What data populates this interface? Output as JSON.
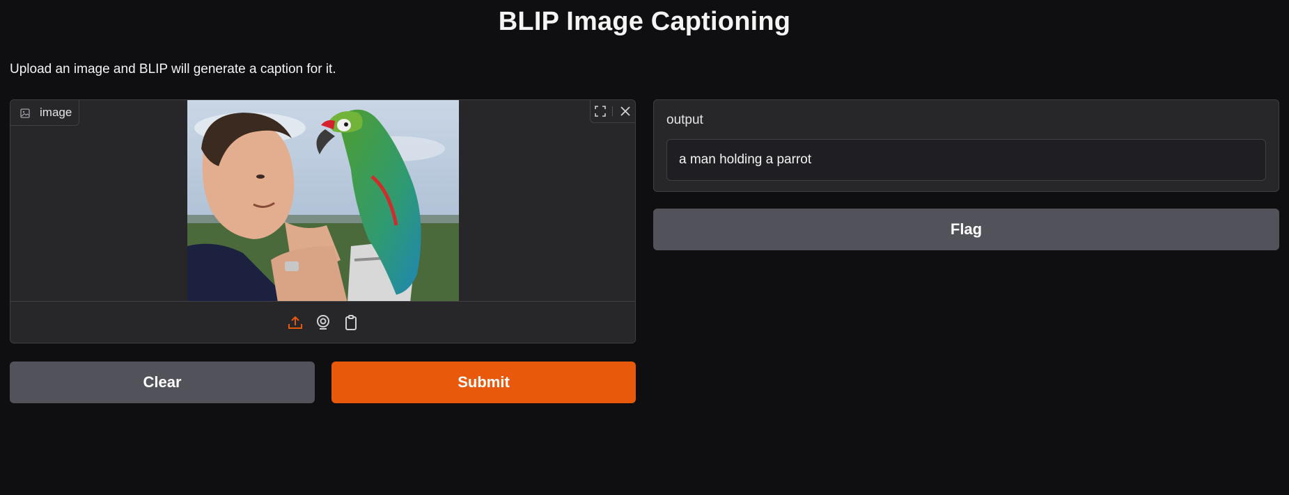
{
  "header": {
    "title": "BLIP Image Captioning",
    "description": "Upload an image and BLIP will generate a caption for it."
  },
  "input_image": {
    "label": "image",
    "label_icon": "image-icon",
    "tools": [
      "fullscreen-icon",
      "close-icon"
    ],
    "sources": [
      {
        "name": "upload-icon",
        "active": true
      },
      {
        "name": "webcam-icon",
        "active": false
      },
      {
        "name": "clipboard-icon",
        "active": false
      }
    ]
  },
  "buttons": {
    "clear_label": "Clear",
    "submit_label": "Submit",
    "flag_label": "Flag"
  },
  "output": {
    "label": "output",
    "value": "a man holding a parrot"
  },
  "colors": {
    "background": "#0f0f11",
    "panel": "#27272a",
    "accent": "#e8590c",
    "secondary_button": "#52525b"
  }
}
